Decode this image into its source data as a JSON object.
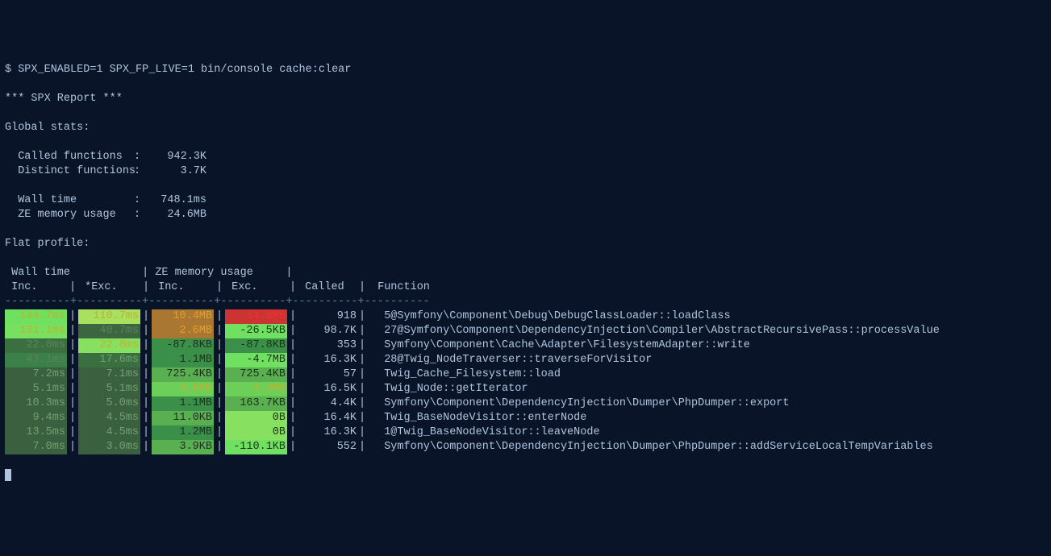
{
  "command": "$ SPX_ENABLED=1 SPX_FP_LIVE=1 bin/console cache:clear",
  "report_title": "*** SPX Report ***",
  "global_stats_label": "Global stats:",
  "stats": {
    "called_functions": {
      "label": "  Called functions",
      "value": "942.3K"
    },
    "distinct_functions": {
      "label": "  Distinct functions",
      "value": "3.7K"
    },
    "wall_time": {
      "label": "  Wall time",
      "value": "748.1ms"
    },
    "ze_memory": {
      "label": "  ZE memory usage",
      "value": "24.6MB"
    }
  },
  "flat_profile_label": "Flat profile:",
  "headers": {
    "group1": " Wall time           | ZE memory usage     |",
    "col_inc1": " Inc.    ",
    "col_exc1": " *Exc.   ",
    "col_inc2": " Inc.    ",
    "col_exc2": " Exc.    ",
    "col_called": " Called ",
    "col_func": " Function"
  },
  "sep": "----------+----------+----------+----------+----------+----------",
  "palette": {
    "row_colors": [
      [
        "#70e060",
        "#a8e060",
        "#aa7733",
        "#cc3333"
      ],
      [
        "#78e060",
        "#3a6640",
        "#aa7733",
        "#70e060"
      ],
      [
        "#3a7040",
        "#88e060",
        "#3a9048",
        "#3a9048"
      ],
      [
        "#3a8048",
        "#3a7040",
        "#3a9048",
        "#70e060"
      ],
      [
        "#3a6040",
        "#3a6040",
        "#5ab050",
        "#5ab050"
      ],
      [
        "#3a6040",
        "#3a6040",
        "#6cd058",
        "#6cd058"
      ],
      [
        "#3a6040",
        "#3a6040",
        "#3a9048",
        "#5ab050"
      ],
      [
        "#3a6040",
        "#3a6040",
        "#5ab050",
        "#88e060"
      ],
      [
        "#3a6040",
        "#3a6040",
        "#3a9048",
        "#88e060"
      ],
      [
        "#3a6040",
        "#3a6040",
        "#5ab050",
        "#70e060"
      ]
    ],
    "text_colors": [
      [
        "#c0b030",
        "#c0b030",
        "#e0a030",
        "#f03030"
      ],
      [
        "#c0b030",
        "#608060",
        "#e0a030",
        "#203020"
      ],
      [
        "#608060",
        "#c0b030",
        "#203020",
        "#203020"
      ],
      [
        "#608060",
        "#70a070",
        "#203020",
        "#203020"
      ],
      [
        "#70a070",
        "#70a070",
        "#203020",
        "#203020"
      ],
      [
        "#70a070",
        "#70a070",
        "#c0b030",
        "#c0b030"
      ],
      [
        "#70a070",
        "#70a070",
        "#203020",
        "#203020"
      ],
      [
        "#70a070",
        "#70a070",
        "#203020",
        "#203020"
      ],
      [
        "#70a070",
        "#70a070",
        "#203020",
        "#203020"
      ],
      [
        "#70a070",
        "#70a070",
        "#203020",
        "#203020"
      ]
    ]
  },
  "rows": [
    {
      "inc1": "144.7ms",
      "exc1": "110.7ms",
      "inc2": "10.4MB",
      "exc2": "14.0MB",
      "called": "918",
      "func": "5@Symfony\\Component\\Debug\\DebugClassLoader::loadClass"
    },
    {
      "inc1": "131.1ms",
      "exc1": "40.7ms",
      "inc2": "2.6MB",
      "exc2": "-26.5KB",
      "called": "98.7K",
      "func": "27@Symfony\\Component\\DependencyInjection\\Compiler\\AbstractRecursivePass::processValue"
    },
    {
      "inc1": "22.0ms",
      "exc1": "22.0ms",
      "inc2": "-87.8KB",
      "exc2": "-87.8KB",
      "called": "353",
      "func": "Symfony\\Component\\Cache\\Adapter\\FilesystemAdapter::write"
    },
    {
      "inc1": "43.1ms",
      "exc1": "17.6ms",
      "inc2": "1.1MB",
      "exc2": "-4.7MB",
      "called": "16.3K",
      "func": "28@Twig_NodeTraverser::traverseForVisitor"
    },
    {
      "inc1": "7.2ms",
      "exc1": "7.1ms",
      "inc2": "725.4KB",
      "exc2": "725.4KB",
      "called": "57",
      "func": "Twig_Cache_Filesystem::load"
    },
    {
      "inc1": "5.1ms",
      "exc1": "5.1ms",
      "inc2": "4.9MB",
      "exc2": "4.9MB",
      "called": "16.5K",
      "func": "Twig_Node::getIterator"
    },
    {
      "inc1": "10.3ms",
      "exc1": "5.0ms",
      "inc2": "1.1MB",
      "exc2": "163.7KB",
      "called": "4.4K",
      "func": "Symfony\\Component\\DependencyInjection\\Dumper\\PhpDumper::export"
    },
    {
      "inc1": "9.4ms",
      "exc1": "4.5ms",
      "inc2": "11.0KB",
      "exc2": "0B",
      "called": "16.4K",
      "func": "Twig_BaseNodeVisitor::enterNode"
    },
    {
      "inc1": "13.5ms",
      "exc1": "4.5ms",
      "inc2": "1.2MB",
      "exc2": "0B",
      "called": "16.3K",
      "func": "1@Twig_BaseNodeVisitor::leaveNode"
    },
    {
      "inc1": "7.0ms",
      "exc1": "3.0ms",
      "inc2": "3.9KB",
      "exc2": "-110.1KB",
      "called": "552",
      "func": "Symfony\\Component\\DependencyInjection\\Dumper\\PhpDumper::addServiceLocalTempVariables"
    }
  ]
}
